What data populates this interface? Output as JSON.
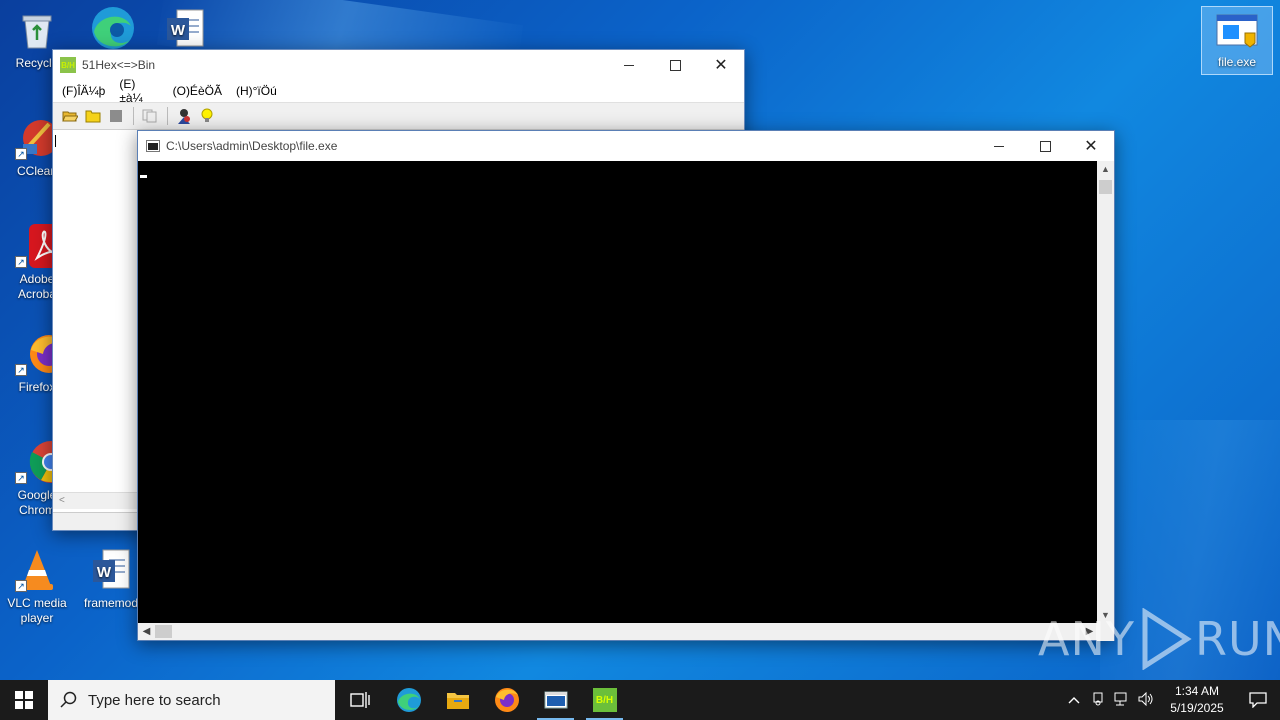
{
  "desktop": {
    "icons": [
      {
        "name": "recycle-bin",
        "label": "Recycle"
      },
      {
        "name": "edge",
        "label": ""
      },
      {
        "name": "word-doc",
        "label": ""
      },
      {
        "name": "ccleaner",
        "label": "CClean"
      },
      {
        "name": "adobe",
        "label": "Adobe Acroba"
      },
      {
        "name": "firefox",
        "label": "Firefox"
      },
      {
        "name": "chrome",
        "label": "Google Chrom"
      },
      {
        "name": "vlc",
        "label": "VLC media player"
      },
      {
        "name": "framemod",
        "label": "framemod"
      },
      {
        "name": "file-exe",
        "label": "file.exe"
      }
    ]
  },
  "hexwin": {
    "title": "51Hex<=>Bin",
    "app_badge": "B/H",
    "menu": [
      "(F)ÎÄ¼þ",
      "(E)±à¼­",
      "(O)ÉèÖÃ",
      "(H)°ïÖú"
    ],
    "scroll_left": "<"
  },
  "conwin": {
    "title": "C:\\Users\\admin\\Desktop\\file.exe"
  },
  "taskbar": {
    "search_placeholder": "Type here to search",
    "app_badge": "B/H",
    "time": "1:34 AM",
    "date": "5/19/2025"
  },
  "watermark": {
    "left": "ANY",
    "right": "RUN"
  },
  "colors": {
    "accent": "#0078d7",
    "taskbar": "#1b1b1b",
    "console_bg": "#000000"
  }
}
